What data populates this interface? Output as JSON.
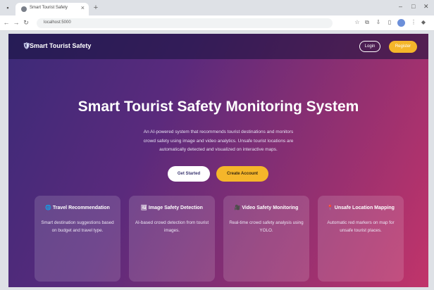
{
  "browser": {
    "tab_title": "Smart Tourist Safety",
    "url": "localhost:5000",
    "new_tab": "+",
    "tab_close": "×"
  },
  "navbar": {
    "brand_icon": "shield-icon",
    "brand": "Smart Tourist Safety",
    "login": "Login",
    "register": "Register"
  },
  "hero": {
    "title": "Smart Tourist Safety Monitoring System",
    "description_lines": [
      "An AI-powered system that recommends tourist destinations and monitors",
      "crowd safety using image and video analytics. Unsafe tourist locations are",
      "automatically detected and visualized on interactive maps."
    ],
    "get_started": "Get Started",
    "create_account": "Create Account"
  },
  "cards": [
    {
      "icon": "globe-icon",
      "icon_glyph": "🌐",
      "title": "Travel Recommendation",
      "desc": "Smart destination suggestions based on budget and travel type."
    },
    {
      "icon": "image-icon",
      "icon_glyph": "🖼",
      "title": "Image Safety Detection",
      "desc": "AI-based crowd detection from tourist images."
    },
    {
      "icon": "video-icon",
      "icon_glyph": "🎥",
      "title": "Video Safety Monitoring",
      "desc": "Real-time crowd safety analysis using YOLO."
    },
    {
      "icon": "map-pin-icon",
      "icon_glyph": "📍",
      "title": "Unsafe Location Mapping",
      "desc": "Automatic red markers on map for unsafe tourist places."
    }
  ],
  "colors": {
    "accent": "#f5b62a",
    "gradient_start": "#3c2a78",
    "gradient_end": "#c1346a"
  }
}
